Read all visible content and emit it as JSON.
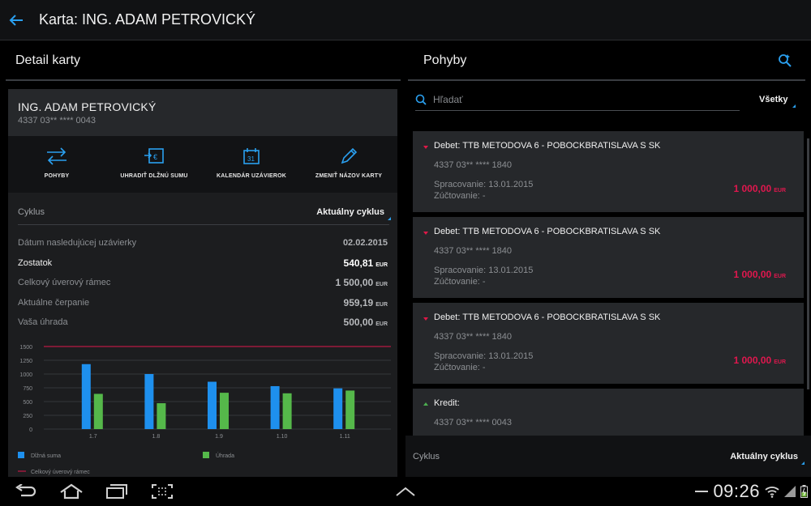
{
  "header": {
    "title": "Karta: ING. ADAM PETROVICKÝ"
  },
  "left": {
    "title": "Detail karty",
    "card": {
      "name": "ING. ADAM PETROVICKÝ",
      "number": "4337 03** **** 0043"
    },
    "actions": [
      {
        "label": "POHYBY",
        "icon": "transfer-icon"
      },
      {
        "label": "UHRADIŤ DLŽNÚ SUMU",
        "icon": "pay-euro-icon"
      },
      {
        "label": "KALENDÁR UZÁVIEROK",
        "icon": "calendar-icon"
      },
      {
        "label": "ZMENIŤ NÁZOV KARTY",
        "icon": "pencil-icon"
      }
    ],
    "cycle": {
      "label": "Cyklus",
      "value": "Aktuálny cyklus"
    },
    "info": {
      "next_closing_label": "Dátum nasledujúcej uzávierky",
      "next_closing_value": "02.02.2015",
      "balance_label": "Zostatok",
      "balance_value": "540,81",
      "limit_label": "Celkový úverový rámec",
      "limit_value": "1 500,00",
      "drawn_label": "Aktuálne čerpanie",
      "drawn_value": "959,19",
      "payment_label": "Vaša úhrada",
      "payment_value": "500,00",
      "currency": "EUR"
    }
  },
  "chart_data": {
    "type": "bar",
    "categories": [
      "1.7",
      "1.8",
      "1.9",
      "1.10",
      "1.11"
    ],
    "series": [
      {
        "name": "Dlžná suma",
        "color": "#1e90ee",
        "values": [
          1180,
          1000,
          860,
          780,
          740
        ]
      },
      {
        "name": "Úhrada",
        "color": "#55b84a",
        "values": [
          640,
          470,
          660,
          650,
          700
        ]
      }
    ],
    "reference_line": {
      "name": "Celkový úverový rámec",
      "value": 1500,
      "color": "#e0174e"
    },
    "yticks": [
      "1500",
      "1250",
      "1000",
      "750",
      "500",
      "250",
      "0"
    ],
    "ylim": [
      0,
      1500
    ],
    "grid": true,
    "legend": "bottom"
  },
  "right": {
    "title": "Pohyby",
    "search": {
      "placeholder": "Hľadať"
    },
    "filter": "Všetky",
    "transactions": [
      {
        "title": "Debet: TTB METODOVA 6 - POBOCKBRATISLAVA  S  SK",
        "card": "4337 03** **** 1840",
        "processed": "Spracovanie: 13.01.2015",
        "booked": "Zúčtovanie: -",
        "amount": "1 000,00",
        "currency": "EUR"
      },
      {
        "title": "Debet: TTB METODOVA 6 - POBOCKBRATISLAVA  S  SK",
        "card": "4337 03** **** 1840",
        "processed": "Spracovanie: 13.01.2015",
        "booked": "Zúčtovanie: -",
        "amount": "1 000,00",
        "currency": "EUR"
      },
      {
        "title": "Debet: TTB METODOVA 6 - POBOCKBRATISLAVA  S  SK",
        "card": "4337 03** **** 1840",
        "processed": "Spracovanie: 13.01.2015",
        "booked": "Zúčtovanie: -",
        "amount": "1 000,00",
        "currency": "EUR"
      },
      {
        "title": "Kredit:",
        "card": "4337 03** **** 0043"
      }
    ],
    "footer": {
      "label": "Cyklus",
      "value": "Aktuálny cyklus"
    }
  },
  "system": {
    "time": "09:26"
  },
  "colors": {
    "accent": "#2aa0f0",
    "debit": "#e0174e",
    "credit": "#4caf50"
  }
}
